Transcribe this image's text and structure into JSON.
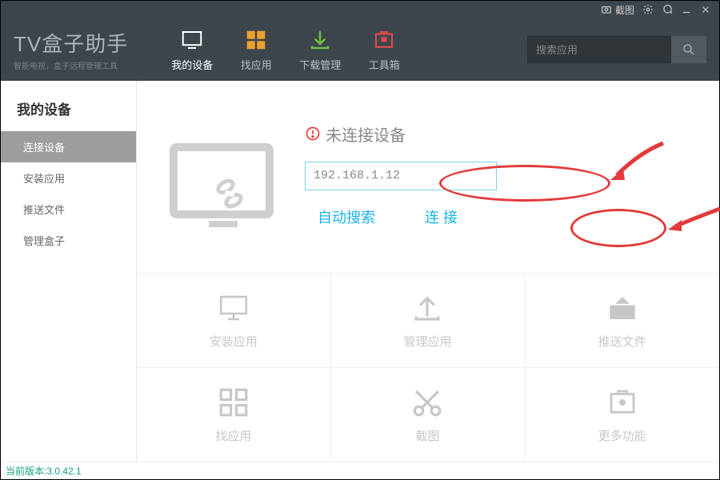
{
  "titlebar": {
    "screenshot_label": "截图"
  },
  "logo": {
    "main": "TV盒子助手",
    "sub": "智能电视，盒子远程管理工具"
  },
  "nav": {
    "tabs": [
      {
        "label": "我的设备"
      },
      {
        "label": "找应用"
      },
      {
        "label": "下载管理"
      },
      {
        "label": "工具箱"
      }
    ]
  },
  "search": {
    "placeholder": "搜索应用"
  },
  "sidebar": {
    "title": "我的设备",
    "items": [
      {
        "label": "连接设备"
      },
      {
        "label": "安装应用"
      },
      {
        "label": "推送文件"
      },
      {
        "label": "管理盒子"
      }
    ]
  },
  "connect": {
    "status": "未连接设备",
    "ip_value": "192.168.1.12",
    "auto_search": "自动搜索",
    "connect": "连 接"
  },
  "grid": {
    "cells": [
      {
        "label": "安装应用"
      },
      {
        "label": "管理应用"
      },
      {
        "label": "推送文件"
      },
      {
        "label": "找应用"
      },
      {
        "label": "截图"
      },
      {
        "label": "更多功能"
      }
    ]
  },
  "footer": {
    "version_label": "当前版本:3.0.42.1"
  }
}
